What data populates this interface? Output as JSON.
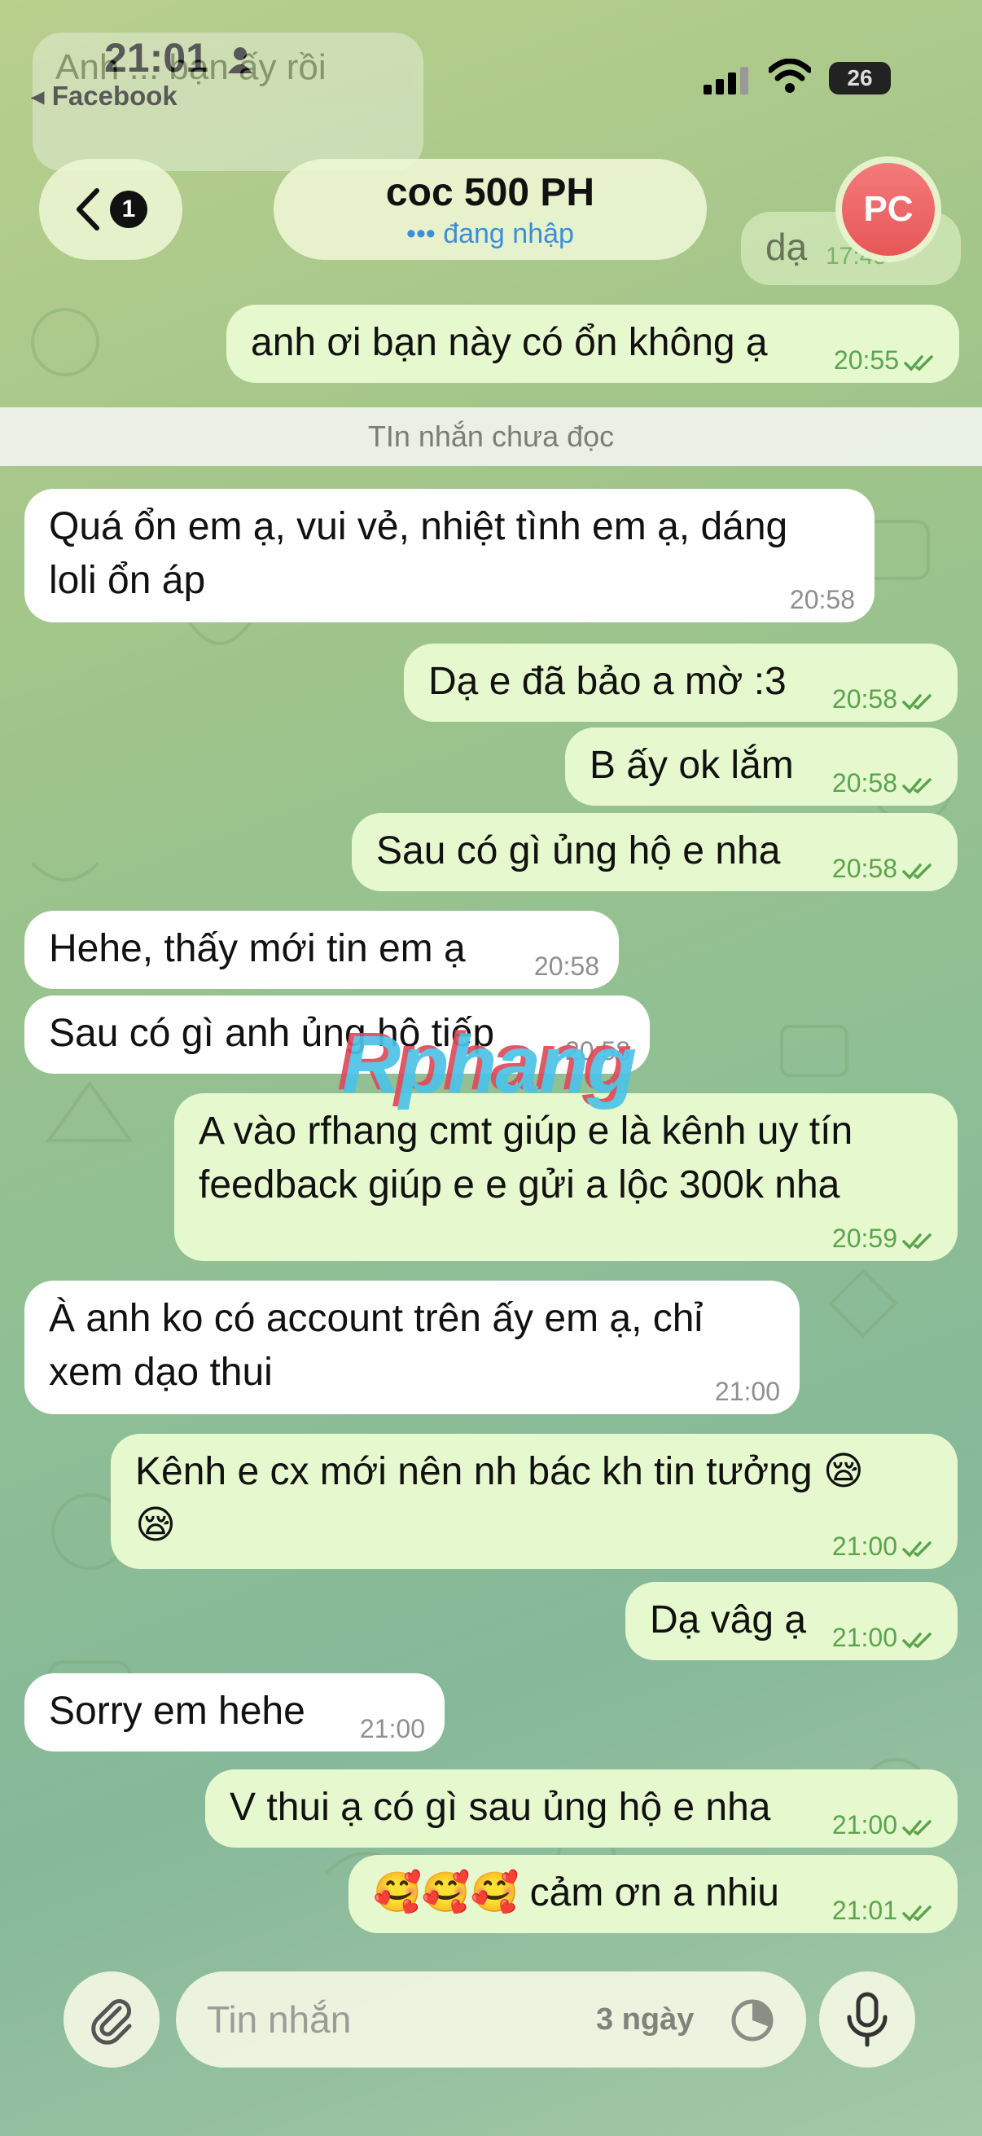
{
  "status": {
    "time": "21:01",
    "back_app": "◂ Facebook",
    "battery": "26"
  },
  "header": {
    "unread_count": "1",
    "title": "coc 500 PH",
    "subtitle": "••• đang nhập",
    "avatar_initials": "PC"
  },
  "ghost": {
    "msg1": "Anh ... bạn ấy rồi",
    "msg2_time": "17:45",
    "msg2": "dạ"
  },
  "divider": "TIn nhắn chưa đọc",
  "messages": [
    {
      "dir": "out",
      "lines": [
        "anh ơi bạn này có ổn không ạ"
      ],
      "time": "20:55"
    },
    {
      "dir": "in",
      "lines": [
        "Quá ổn em ạ, vui vẻ, nhiệt tình em ạ, dáng",
        "loli ổn áp"
      ],
      "time": "20:58"
    },
    {
      "dir": "out",
      "lines": [
        "Dạ e đã bảo a mờ :3"
      ],
      "time": "20:58"
    },
    {
      "dir": "out",
      "lines": [
        "B ấy ok lắm"
      ],
      "time": "20:58"
    },
    {
      "dir": "out",
      "lines": [
        "Sau có gì ủng hộ e nha"
      ],
      "time": "20:58"
    },
    {
      "dir": "in",
      "lines": [
        "Hehe, thấy mới tin em ạ"
      ],
      "time": "20:58"
    },
    {
      "dir": "in",
      "lines": [
        "Sau có gì anh ủng hộ tiếp"
      ],
      "time": "20:58"
    },
    {
      "dir": "out",
      "lines": [
        "A vào rfhang cmt giúp e là kênh uy tín",
        "feedback giúp e e gửi a lộc 300k nha"
      ],
      "time": "20:59"
    },
    {
      "dir": "in",
      "lines": [
        "À anh ko có account trên ấy em ạ, chỉ",
        "xem dạo thui"
      ],
      "time": "21:00"
    },
    {
      "dir": "out",
      "lines": [
        "Kênh e cx mới nên nh bác kh tin tưởng 😪",
        "😪"
      ],
      "time": "21:00"
    },
    {
      "dir": "out",
      "lines": [
        "Dạ vâg ạ"
      ],
      "time": "21:00"
    },
    {
      "dir": "in",
      "lines": [
        "Sorry em hehe"
      ],
      "time": "21:00"
    },
    {
      "dir": "out",
      "lines": [
        "V thui ạ có gì sau ủng hộ e nha"
      ],
      "time": "21:00"
    },
    {
      "dir": "out",
      "lines": [
        "🥰🥰🥰 cảm ơn a nhiu"
      ],
      "time": "21:01"
    }
  ],
  "watermark": "Rphang",
  "input": {
    "placeholder": "Tin nhắn",
    "timer_label": "3 ngày"
  },
  "icons": {
    "attach": "paperclip-icon",
    "mic": "microphone-icon",
    "timer": "timer-icon",
    "back": "chevron-left-icon"
  },
  "colors": {
    "incoming_bubble": "#ffffff",
    "outgoing_bubble": "#e6f8cd",
    "outgoing_meta": "#5aa44e",
    "typing_text": "#3b8fd9",
    "avatar": "#e65757"
  }
}
